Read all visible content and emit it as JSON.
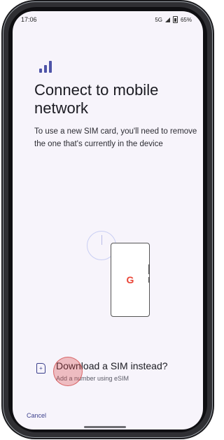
{
  "status_bar": {
    "time": "17:06",
    "network": "5G",
    "battery": "65%"
  },
  "header": {
    "icon": "signal-bars-icon",
    "title": "Connect to mobile network"
  },
  "body": {
    "description": "To use a new SIM card, you'll need to remove the one that's currently in the device"
  },
  "download_option": {
    "icon": "esim-icon",
    "title": "Download a SIM instead?",
    "subtitle": "Add a number using eSIM"
  },
  "footer": {
    "cancel_label": "Cancel"
  },
  "colors": {
    "accent": "#4e54a8",
    "background": "#f7f4fb",
    "text": "#1b1b22"
  }
}
